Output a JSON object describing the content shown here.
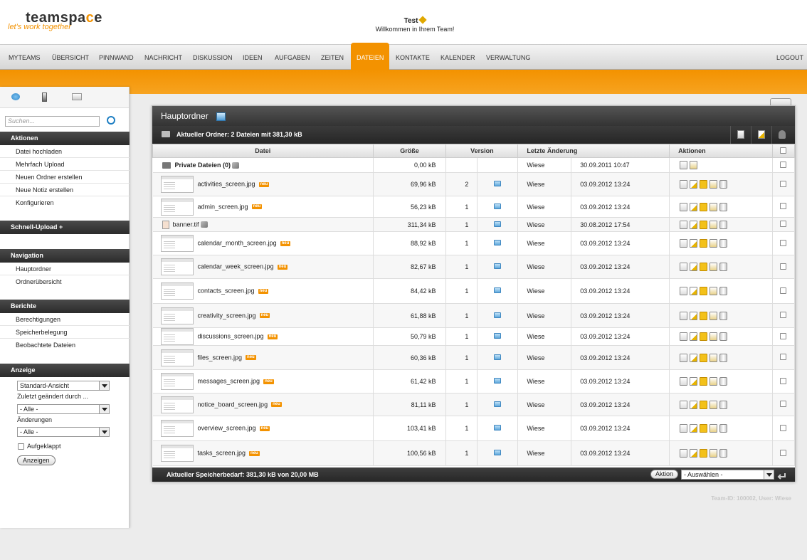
{
  "header": {
    "logo_text_a": "teamspa",
    "logo_text_b": "c",
    "logo_text_c": "e",
    "tagline": "let's work together",
    "title": "Test",
    "subtitle": "Willkommen in Ihrem Team!"
  },
  "nav": {
    "items": [
      "MYTEAMS",
      "ÜBERSICHT",
      "PINNWAND",
      "NACHRICHT",
      "DISKUSSION",
      "IDEEN",
      "AUFGABEN",
      "ZEITEN",
      "DATEIEN",
      "KONTAKTE",
      "KALENDER",
      "VERWALTUNG"
    ],
    "active": "DATEIEN",
    "logout": "LOGOUT"
  },
  "sidebar": {
    "search_placeholder": "Suchen...",
    "aktionen_title": "Aktionen",
    "aktionen": [
      "Datei hochladen",
      "Mehrfach Upload",
      "Neuen Ordner erstellen",
      "Neue Notiz erstellen",
      "Konfigurieren"
    ],
    "schnell_upload": "Schnell-Upload +",
    "navigation_title": "Navigation",
    "navigation": [
      "Hauptordner",
      "Ordnerübersicht"
    ],
    "berichte_title": "Berichte",
    "berichte": [
      "Berechtigungen",
      "Speicherbelegung",
      "Beobachtete Dateien"
    ],
    "anzeige_title": "Anzeige",
    "view_select": "Standard-Ansicht",
    "changed_by_label": "Zuletzt geändert durch ...",
    "changed_by_select": "- Alle -",
    "changes_label": "Änderungen",
    "changes_select": "- Alle -",
    "expanded_label": "Aufgeklappt",
    "show_button": "Anzeigen"
  },
  "panel": {
    "title": "Hauptordner",
    "current_folder": "Aktueller Ordner: 2 Dateien mit 381,30 kB",
    "columns": {
      "name": "Datei",
      "size": "Größe",
      "version": "Version",
      "changed": "Letzte Änderung",
      "actions": "Aktionen"
    },
    "rows": [
      {
        "name": "Private Dateien (0)",
        "type": "folder",
        "size": "0,00 kB",
        "version": "",
        "user": "Wiese",
        "date": "30.09.2011 10:47",
        "neu": false
      },
      {
        "name": "activities_screen.jpg",
        "type": "thumb",
        "size": "69,96 kB",
        "version": "2",
        "user": "Wiese",
        "date": "03.09.2012 13:24",
        "neu": true
      },
      {
        "name": "admin_screen.jpg",
        "type": "thumb",
        "size": "56,23 kB",
        "version": "1",
        "user": "Wiese",
        "date": "03.09.2012 13:24",
        "neu": true
      },
      {
        "name": "banner.tif",
        "type": "small",
        "size": "311,34 kB",
        "version": "1",
        "user": "Wiese",
        "date": "30.08.2012 17:54",
        "neu": false
      },
      {
        "name": "calendar_month_screen.jpg",
        "type": "thumb",
        "size": "88,92 kB",
        "version": "1",
        "user": "Wiese",
        "date": "03.09.2012 13:24",
        "neu": true
      },
      {
        "name": "calendar_week_screen.jpg",
        "type": "thumb",
        "size": "82,67 kB",
        "version": "1",
        "user": "Wiese",
        "date": "03.09.2012 13:24",
        "neu": true
      },
      {
        "name": "contacts_screen.jpg",
        "type": "thumb",
        "size": "84,42 kB",
        "version": "1",
        "user": "Wiese",
        "date": "03.09.2012 13:24",
        "neu": true
      },
      {
        "name": "creativity_screen.jpg",
        "type": "thumb",
        "size": "61,88 kB",
        "version": "1",
        "user": "Wiese",
        "date": "03.09.2012 13:24",
        "neu": true
      },
      {
        "name": "discussions_screen.jpg",
        "type": "thumb",
        "size": "50,79 kB",
        "version": "1",
        "user": "Wiese",
        "date": "03.09.2012 13:24",
        "neu": true
      },
      {
        "name": "files_screen.jpg",
        "type": "thumb",
        "size": "60,36 kB",
        "version": "1",
        "user": "Wiese",
        "date": "03.09.2012 13:24",
        "neu": true
      },
      {
        "name": "messages_screen.jpg",
        "type": "thumb",
        "size": "61,42 kB",
        "version": "1",
        "user": "Wiese",
        "date": "03.09.2012 13:24",
        "neu": true
      },
      {
        "name": "notice_board_screen.jpg",
        "type": "thumb",
        "size": "81,11 kB",
        "version": "1",
        "user": "Wiese",
        "date": "03.09.2012 13:24",
        "neu": true
      },
      {
        "name": "overview_screen.jpg",
        "type": "thumb",
        "size": "103,41 kB",
        "version": "1",
        "user": "Wiese",
        "date": "03.09.2012 13:24",
        "neu": true
      },
      {
        "name": "tasks_screen.jpg",
        "type": "thumb",
        "size": "100,56 kB",
        "version": "1",
        "user": "Wiese",
        "date": "03.09.2012 13:24",
        "neu": true
      }
    ],
    "neu_badge": "neu",
    "footer_text": "Aktueller Speicherbedarf: 381,30 kB von 20,00 MB",
    "action_button": "Aktion",
    "action_select": "- Auswählen -"
  },
  "team_id": "Team-ID: 100002, User: Wiese",
  "colors": {
    "accent": "#f39200",
    "dark_bar": "#2b2b2b"
  }
}
